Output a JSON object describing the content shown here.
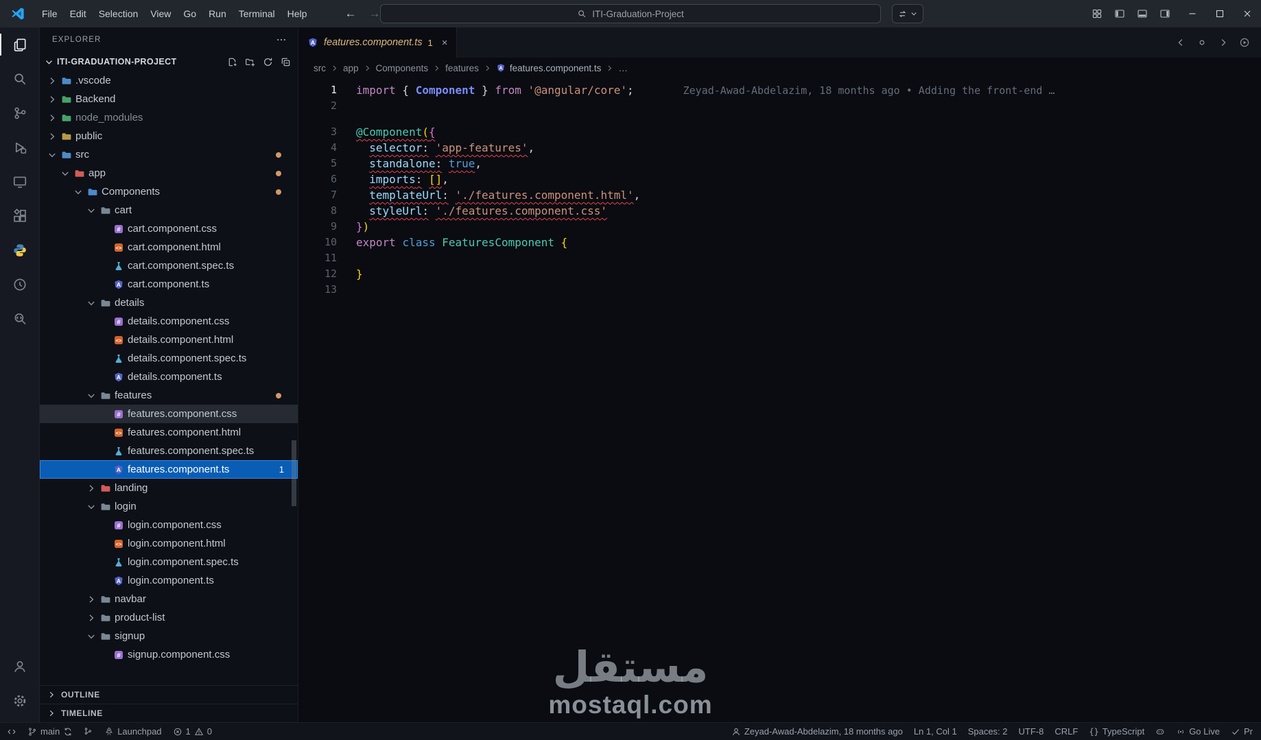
{
  "titlebar": {
    "search_text": "ITI-Graduation-Project",
    "menus": [
      "File",
      "Edit",
      "Selection",
      "View",
      "Go",
      "Run",
      "Terminal",
      "Help"
    ]
  },
  "activity_bar": {
    "top": [
      {
        "name": "explorer",
        "icon": "files",
        "active": true
      },
      {
        "name": "search",
        "icon": "search",
        "active": false
      },
      {
        "name": "source-control",
        "icon": "scm",
        "active": false
      },
      {
        "name": "run-and-debug",
        "icon": "debug",
        "active": false
      },
      {
        "name": "remote-explorer",
        "icon": "monitor",
        "active": false
      },
      {
        "name": "extensions",
        "icon": "extensions",
        "active": false
      },
      {
        "name": "python",
        "icon": "python",
        "active": false
      },
      {
        "name": "live-share",
        "icon": "circleArrow",
        "active": false
      },
      {
        "name": "code-search",
        "icon": "magCode",
        "active": false
      }
    ],
    "bottom": [
      {
        "name": "accounts",
        "icon": "person"
      },
      {
        "name": "settings",
        "icon": "gear"
      }
    ]
  },
  "explorer": {
    "header": "EXPLORER",
    "project": "ITI-GRADUATION-PROJECT",
    "sections": [
      "OUTLINE",
      "TIMELINE"
    ],
    "tree": [
      {
        "label": ".vscode",
        "kind": "folder",
        "level": 1,
        "expanded": false,
        "color": "#4e8ac8"
      },
      {
        "label": "Backend",
        "kind": "folder",
        "level": 1,
        "expanded": false,
        "color": "#47a169"
      },
      {
        "label": "node_modules",
        "kind": "folder",
        "level": 1,
        "expanded": false,
        "color": "#47a169",
        "dim": true
      },
      {
        "label": "public",
        "kind": "folder",
        "level": 1,
        "expanded": false,
        "color": "#b99a45"
      },
      {
        "label": "src",
        "kind": "folder",
        "level": 1,
        "expanded": true,
        "color": "#4e8ac8",
        "dot": true
      },
      {
        "label": "app",
        "kind": "folder",
        "level": 2,
        "expanded": true,
        "color": "#d35b5b",
        "dot": true
      },
      {
        "label": "Components",
        "kind": "folder",
        "level": 3,
        "expanded": true,
        "color": "#4e8ac8",
        "dot": true
      },
      {
        "label": "cart",
        "kind": "folder",
        "level": 4,
        "expanded": true,
        "color": "#7a8794"
      },
      {
        "label": "cart.component.css",
        "kind": "file",
        "level": 5,
        "icon": "css"
      },
      {
        "label": "cart.component.html",
        "kind": "file",
        "level": 5,
        "icon": "html"
      },
      {
        "label": "cart.component.spec.ts",
        "kind": "file",
        "level": 5,
        "icon": "spec"
      },
      {
        "label": "cart.component.ts",
        "kind": "file",
        "level": 5,
        "icon": "ng"
      },
      {
        "label": "details",
        "kind": "folder",
        "level": 4,
        "expanded": true,
        "color": "#7a8794"
      },
      {
        "label": "details.component.css",
        "kind": "file",
        "level": 5,
        "icon": "css"
      },
      {
        "label": "details.component.html",
        "kind": "file",
        "level": 5,
        "icon": "html"
      },
      {
        "label": "details.component.spec.ts",
        "kind": "file",
        "level": 5,
        "icon": "spec"
      },
      {
        "label": "details.component.ts",
        "kind": "file",
        "level": 5,
        "icon": "ng"
      },
      {
        "label": "features",
        "kind": "folder",
        "level": 4,
        "expanded": true,
        "color": "#7a8794",
        "dot": true
      },
      {
        "label": "features.component.css",
        "kind": "file",
        "level": 5,
        "icon": "css",
        "highlighted": true
      },
      {
        "label": "features.component.html",
        "kind": "file",
        "level": 5,
        "icon": "html"
      },
      {
        "label": "features.component.spec.ts",
        "kind": "file",
        "level": 5,
        "icon": "spec"
      },
      {
        "label": "features.component.ts",
        "kind": "file",
        "level": 5,
        "icon": "ng",
        "selected": true,
        "badge": "1"
      },
      {
        "label": "landing",
        "kind": "folder",
        "level": 4,
        "expanded": false,
        "color": "#d35b5b"
      },
      {
        "label": "login",
        "kind": "folder",
        "level": 4,
        "expanded": true,
        "color": "#7a8794"
      },
      {
        "label": "login.component.css",
        "kind": "file",
        "level": 5,
        "icon": "css"
      },
      {
        "label": "login.component.html",
        "kind": "file",
        "level": 5,
        "icon": "html"
      },
      {
        "label": "login.component.spec.ts",
        "kind": "file",
        "level": 5,
        "icon": "spec"
      },
      {
        "label": "login.component.ts",
        "kind": "file",
        "level": 5,
        "icon": "ng"
      },
      {
        "label": "navbar",
        "kind": "folder",
        "level": 4,
        "expanded": false,
        "color": "#7a8794"
      },
      {
        "label": "product-list",
        "kind": "folder",
        "level": 4,
        "expanded": false,
        "color": "#7a8794"
      },
      {
        "label": "signup",
        "kind": "folder",
        "level": 4,
        "expanded": true,
        "color": "#7a8794"
      },
      {
        "label": "signup.component.css",
        "kind": "file",
        "level": 5,
        "icon": "css"
      }
    ]
  },
  "editor": {
    "tab": {
      "label": "features.component.ts",
      "badge": "1"
    },
    "breadcrumbs": [
      "src",
      "app",
      "Components",
      "features"
    ],
    "breadcrumb_file": "features.component.ts",
    "breadcrumb_tail": "…",
    "lines": [
      {
        "n": "1",
        "active": true,
        "blame": "Zeyad-Awad-Abdelazim, 18 months ago • Adding the front-end …",
        "tokens": [
          {
            "t": "import",
            "c": "kw"
          },
          {
            "t": " { ",
            "c": "fg"
          },
          {
            "t": "Component",
            "c": "imp"
          },
          {
            "t": " } ",
            "c": "fg"
          },
          {
            "t": "from",
            "c": "kw"
          },
          {
            "t": " ",
            "c": "fg"
          },
          {
            "t": "'@angular/core'",
            "c": "str"
          },
          {
            "t": ";",
            "c": "fg"
          }
        ]
      },
      {
        "n": "2",
        "tokens": []
      },
      {
        "spacer": true
      },
      {
        "n": "3",
        "tokens": [
          {
            "t": "@Component",
            "c": "dec",
            "e": true
          },
          {
            "t": "(",
            "c": "b1",
            "e": true
          },
          {
            "t": "{",
            "c": "b2",
            "e": true
          }
        ]
      },
      {
        "n": "4",
        "tokens": [
          {
            "t": "  ",
            "c": "fg"
          },
          {
            "t": "selector",
            "c": "prop",
            "e": true
          },
          {
            "t": ":",
            "c": "fg",
            "e": true
          },
          {
            "t": " ",
            "c": "fg"
          },
          {
            "t": "'app-features'",
            "c": "str",
            "e": true
          },
          {
            "t": ",",
            "c": "fg"
          }
        ]
      },
      {
        "n": "5",
        "tokens": [
          {
            "t": "  ",
            "c": "fg"
          },
          {
            "t": "standalone",
            "c": "prop",
            "e": true
          },
          {
            "t": ":",
            "c": "fg",
            "e": true
          },
          {
            "t": " ",
            "c": "fg"
          },
          {
            "t": "true",
            "c": "kw2",
            "e": true
          },
          {
            "t": ",",
            "c": "fg"
          }
        ]
      },
      {
        "n": "6",
        "tokens": [
          {
            "t": "  ",
            "c": "fg"
          },
          {
            "t": "imports",
            "c": "prop",
            "e": true
          },
          {
            "t": ":",
            "c": "fg",
            "e": true
          },
          {
            "t": " ",
            "c": "fg"
          },
          {
            "t": "[]",
            "c": "b1",
            "e": true
          },
          {
            "t": ",",
            "c": "fg"
          }
        ]
      },
      {
        "n": "7",
        "tokens": [
          {
            "t": "  ",
            "c": "fg"
          },
          {
            "t": "templateUrl",
            "c": "prop",
            "e": true
          },
          {
            "t": ":",
            "c": "fg",
            "e": true
          },
          {
            "t": " ",
            "c": "fg"
          },
          {
            "t": "'./features.component.html'",
            "c": "str",
            "e": true
          },
          {
            "t": ",",
            "c": "fg"
          }
        ]
      },
      {
        "n": "8",
        "tokens": [
          {
            "t": "  ",
            "c": "fg"
          },
          {
            "t": "styleUrl",
            "c": "prop",
            "e": true
          },
          {
            "t": ":",
            "c": "fg",
            "e": true
          },
          {
            "t": " ",
            "c": "fg"
          },
          {
            "t": "'./features.component.css'",
            "c": "str",
            "e": true
          }
        ]
      },
      {
        "n": "9",
        "tokens": [
          {
            "t": "}",
            "c": "b2"
          },
          {
            "t": ")",
            "c": "b1"
          }
        ]
      },
      {
        "n": "10",
        "tokens": [
          {
            "t": "export",
            "c": "kw"
          },
          {
            "t": " ",
            "c": "fg"
          },
          {
            "t": "class",
            "c": "kw2"
          },
          {
            "t": " ",
            "c": "fg"
          },
          {
            "t": "FeaturesComponent",
            "c": "cls"
          },
          {
            "t": " ",
            "c": "fg"
          },
          {
            "t": "{",
            "c": "b1"
          }
        ]
      },
      {
        "n": "11",
        "tokens": []
      },
      {
        "n": "12",
        "tokens": [
          {
            "t": "}",
            "c": "b1"
          }
        ]
      },
      {
        "n": "13",
        "tokens": []
      }
    ]
  },
  "statusbar": {
    "left": [
      {
        "name": "remote-indicator",
        "parts": [
          {
            "i": "remote"
          }
        ]
      },
      {
        "name": "git-branch",
        "parts": [
          {
            "i": "branch"
          },
          {
            "t": "main"
          },
          {
            "i": "sync"
          }
        ]
      },
      {
        "name": "scm-graph",
        "parts": [
          {
            "i": "graph"
          }
        ]
      },
      {
        "name": "launchpad",
        "parts": [
          {
            "i": "rocket"
          },
          {
            "t": "Launchpad"
          }
        ]
      },
      {
        "name": "problems",
        "parts": [
          {
            "i": "error"
          },
          {
            "t": "1"
          },
          {
            "i": "warning"
          },
          {
            "t": "0"
          }
        ]
      }
    ],
    "right": [
      {
        "name": "git-blame",
        "parts": [
          {
            "i": "person"
          },
          {
            "t": "Zeyad-Awad-Abdelazim, 18 months ago"
          }
        ]
      },
      {
        "name": "cursor-position",
        "parts": [
          {
            "t": "Ln 1, Col 1"
          }
        ]
      },
      {
        "name": "indentation",
        "parts": [
          {
            "t": "Spaces: 2"
          }
        ]
      },
      {
        "name": "encoding",
        "parts": [
          {
            "t": "UTF-8"
          }
        ]
      },
      {
        "name": "eol",
        "parts": [
          {
            "t": "CRLF"
          }
        ]
      },
      {
        "name": "language-mode",
        "parts": [
          {
            "i": "braces"
          },
          {
            "t": "TypeScript"
          }
        ]
      },
      {
        "name": "copilot",
        "parts": [
          {
            "i": "copilot"
          }
        ]
      },
      {
        "name": "go-live",
        "parts": [
          {
            "i": "broadcast"
          },
          {
            "t": "Go Live"
          }
        ]
      },
      {
        "name": "prettier",
        "parts": [
          {
            "i": "check"
          },
          {
            "t": "Pr"
          }
        ]
      }
    ]
  },
  "watermark": {
    "title": "مستقل",
    "domain": "mostaql.com"
  },
  "colors": {
    "accent": "#3794ff",
    "selection": "#0a5db5",
    "modified_dot": "#d19a66",
    "error": "#e4454a",
    "warning": "#cca700"
  }
}
